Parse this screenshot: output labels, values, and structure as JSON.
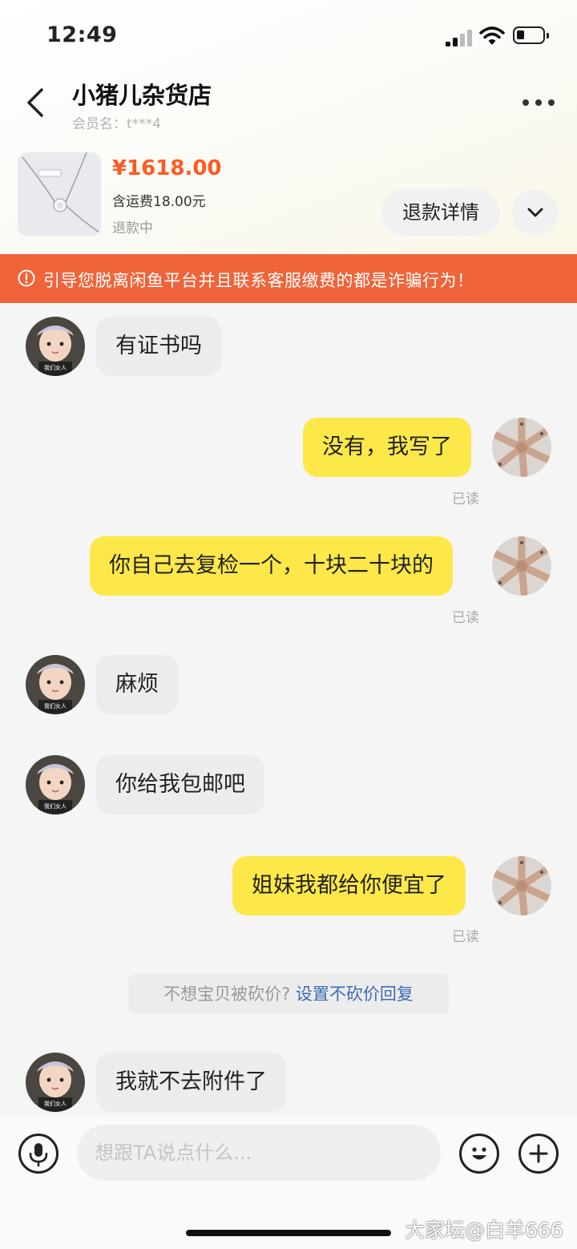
{
  "status_bar": {
    "time": "12:49"
  },
  "header": {
    "shop_name": "小猪儿杂货店",
    "member_name": "会员名：t***4"
  },
  "product": {
    "price": "¥1618.00",
    "shipping": "含运费18.00元",
    "status": "退款中",
    "refund_button": "退款详情"
  },
  "warning": {
    "text": "引导您脱离闲鱼平台并且联系客服缴费的都是诈骗行为！"
  },
  "messages": [
    {
      "side": "in",
      "text": "有证书吗"
    },
    {
      "side": "out",
      "text": "没有，我写了",
      "receipt": "已读"
    },
    {
      "side": "out",
      "text": "你自己去复检一个，十块二十块的",
      "receipt": "已读"
    },
    {
      "side": "in",
      "text": "麻烦"
    },
    {
      "side": "in",
      "text": "你给我包邮吧"
    },
    {
      "side": "out",
      "text": "姐妹我都给你便宜了",
      "receipt": "已读"
    },
    {
      "side": "in",
      "text": "我就不去附件了"
    }
  ],
  "system_tip": {
    "text": "不想宝贝被砍价?",
    "link": "设置不砍价回复"
  },
  "avatar_caption": "我们女人",
  "input": {
    "placeholder": "想跟TA说点什么..."
  },
  "watermark": "大家坛@白羊666",
  "icons": {
    "back": "chevron-left-icon",
    "more": "more-dots-icon",
    "expand": "chevron-down-icon",
    "warning": "warning-circle-icon",
    "voice": "microphone-icon",
    "emoji": "emoji-icon",
    "add": "plus-icon"
  },
  "colors": {
    "price": "#ff5a1f",
    "warning_bg": "#f0643a",
    "out_bubble": "#fde84a",
    "in_bubble": "#ececec",
    "link": "#3b6cb5"
  }
}
